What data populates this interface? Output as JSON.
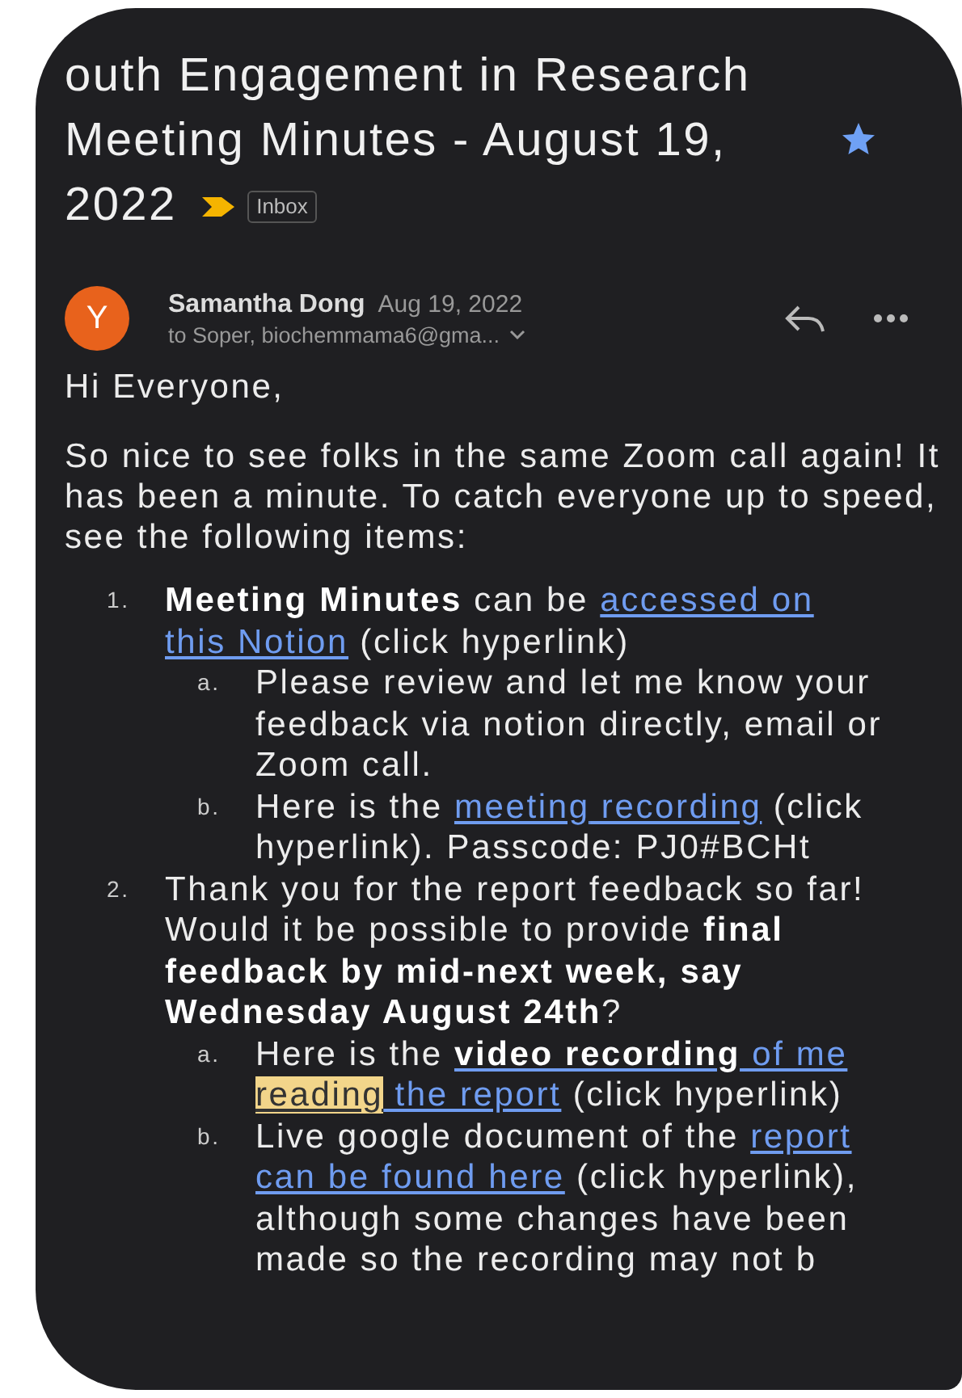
{
  "subject": {
    "title": "outh Engagement in Research Meeting Minutes - August 19, 2022",
    "label": "Inbox",
    "starred": true,
    "important": true
  },
  "message": {
    "avatar": {
      "letter": "Y",
      "color": "#e8621c"
    },
    "sender": "Samantha Dong",
    "date": "Aug 19, 2022",
    "recipients": "to Soper, biochemmama6@gma..."
  },
  "body": {
    "greeting": "Hi Everyone,",
    "intro": "So nice to see folks in the same Zoom call again! It has been a minute. To catch everyone up to speed, see the following items:",
    "items": [
      {
        "marker": "1.",
        "segments": [
          {
            "text": "**Meeting Minutes** can be "
          },
          {
            "text": "accessed on",
            "kind": "link"
          },
          {
            "text": " this Notion",
            "kind": "link"
          },
          {
            "text": " (click hyperlink)"
          }
        ],
        "children": [
          {
            "marker": "a.",
            "segments": [
              {
                "text": "Please review and let me know your feedback via notion directly, email or Zoom call."
              }
            ]
          },
          {
            "marker": "b.",
            "segments": [
              {
                "text": "Here is the "
              },
              {
                "text": "meeting",
                "kind": "link"
              },
              {
                "text": " recording",
                "kind": "link"
              },
              {
                "text": " (click hyperlink). Passcode: PJ0#BCHt"
              }
            ]
          }
        ]
      },
      {
        "marker": "2.",
        "segments": [
          {
            "text": "Thank you for the report feedback so far! Would it be possible to provide **final feedback by mid-next week, say Wednesday August 24th**?"
          }
        ],
        "children": [
          {
            "marker": "a.",
            "segments": [
              {
                "text": "Here is the "
              },
              {
                "text": "**video recording** of me ",
                "kind": "link"
              },
              {
                "text": "reading",
                "kind": "link",
                "highlighted": true
              },
              {
                "text": " the report",
                "kind": "link"
              },
              {
                "text": " (click hyperlink)"
              }
            ]
          },
          {
            "marker": "b.",
            "segments": [
              {
                "text": "Live google document of the "
              },
              {
                "text": "report",
                "kind": "link"
              },
              {
                "text": " can be found here",
                "kind": "link"
              },
              {
                "text": " (click hyperlink), although some changes have been made so the recording may not b"
              }
            ]
          }
        ]
      }
    ]
  }
}
